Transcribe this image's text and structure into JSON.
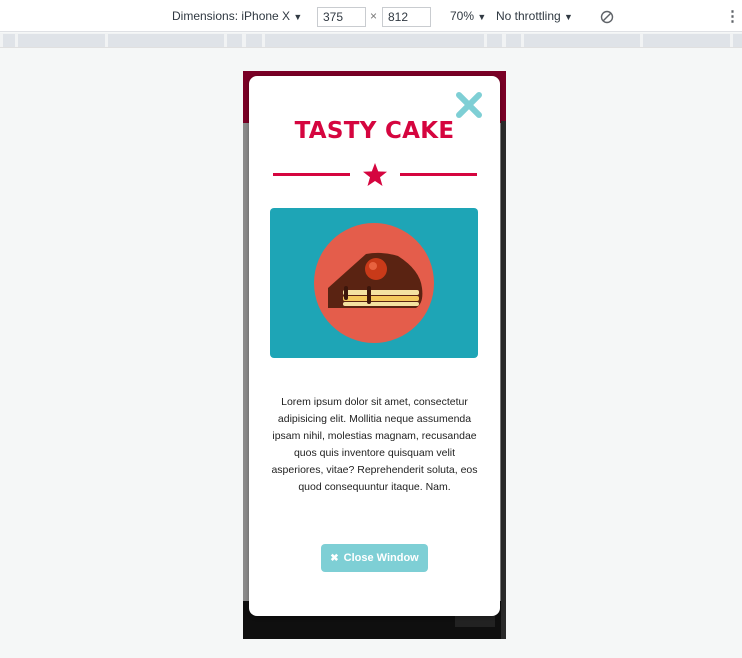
{
  "devtools": {
    "device_label": "Dimensions: iPhone X",
    "width_value": "375",
    "times": "×",
    "height_value": "812",
    "zoom": "70%",
    "throttle": "No throttling",
    "dropdown_arrow": "▼",
    "menu_icon": "⋮"
  },
  "modal": {
    "title": "TASTY CAKE",
    "description": "Lorem ipsum dolor sit amet, consectetur adipisicing elit. Mollitia neque assumenda ipsam nihil, molestias magnam, recusandae quos quis inventore quisquam velit asperiores, vitae? Reprehenderit soluta, eos quod consequuntur itaque. Nam.",
    "close_button_label": "Close Window",
    "close_button_icon": "✖"
  },
  "colors": {
    "accent": "#d5053f",
    "card_bg": "#1ea5b6",
    "button_bg": "#7ecfd5",
    "close_icon": "#7ecfd5"
  },
  "icons": [
    "close-icon",
    "star-icon",
    "cake-icon",
    "no-throttle-icon",
    "more-options-icon"
  ]
}
